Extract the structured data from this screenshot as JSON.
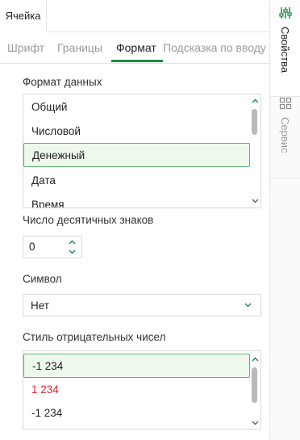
{
  "top_tab": {
    "label": "Ячейка"
  },
  "sub_tabs": [
    "Шрифт",
    "Границы",
    "Формат",
    "Подсказка по вводу"
  ],
  "active_sub_tab": "Формат",
  "data_format": {
    "label": "Формат данных",
    "options": [
      "Общий",
      "Числовой",
      "Денежный",
      "Дата",
      "Время"
    ],
    "selected": "Денежный"
  },
  "decimal_places": {
    "label": "Число десятичных знаков",
    "value": "0"
  },
  "symbol": {
    "label": "Символ",
    "value": "Нет"
  },
  "negative_style": {
    "label": "Стиль отрицательных чисел",
    "options": [
      "-1 234",
      "1 234",
      "-1 234"
    ],
    "selected_index": 0,
    "red_index": 1
  },
  "rail": {
    "properties_label": "Свойства",
    "service_label": "Сервис"
  },
  "colors": {
    "accent": "#1e8a45",
    "selected_bg": "#eef8ec",
    "selected_border": "#5cb36d",
    "negative_red": "#e0262b"
  },
  "icons": [
    "sliders-icon",
    "grid-icon",
    "chevron-up-icon",
    "chevron-down-icon"
  ]
}
